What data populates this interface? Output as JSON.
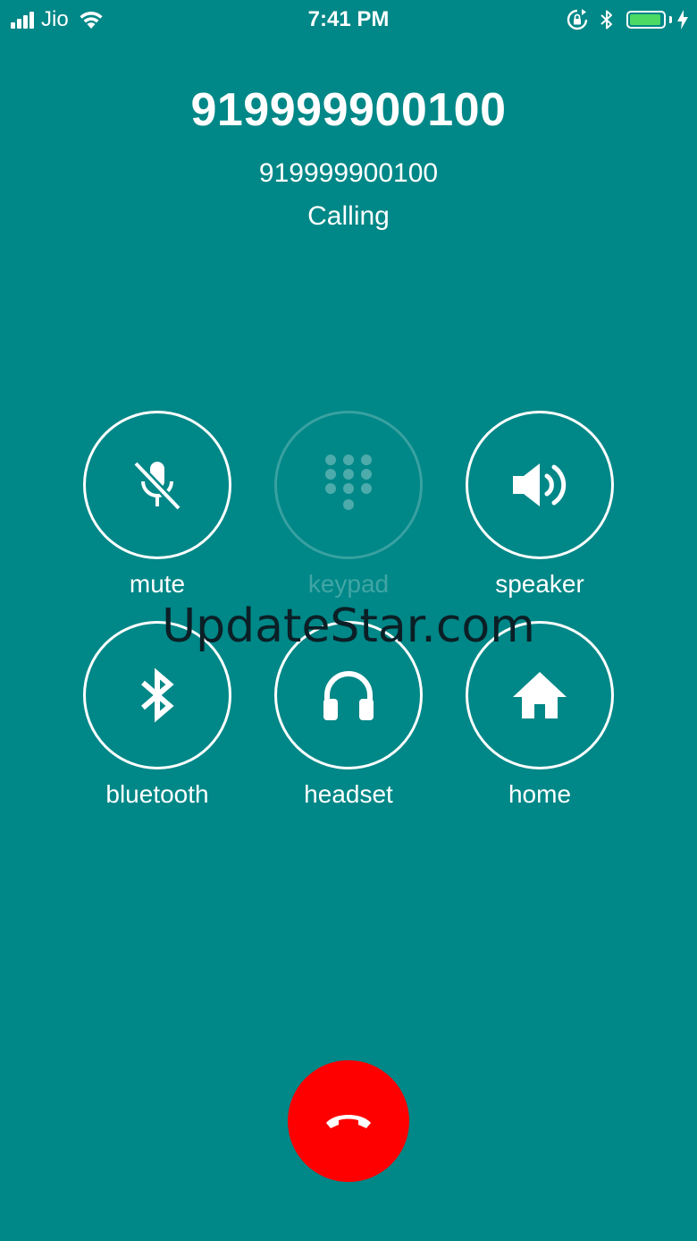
{
  "status_bar": {
    "carrier": "Jio",
    "time": "7:41 PM",
    "signal_icon": "cellular-signal-icon",
    "wifi_icon": "wifi-icon",
    "rotation_lock_icon": "rotation-lock-icon",
    "bluetooth_icon": "bluetooth-icon",
    "battery_icon": "battery-icon",
    "battery_level": 0.95,
    "battery_color": "#4cd964",
    "charging_icon": "charging-bolt-icon"
  },
  "call": {
    "caller_name": "919999900100",
    "caller_number": "919999900100",
    "status": "Calling"
  },
  "controls": [
    {
      "id": "mute",
      "label": "mute",
      "icon": "microphone-muted-icon",
      "enabled": true
    },
    {
      "id": "keypad",
      "label": "keypad",
      "icon": "keypad-icon",
      "enabled": false
    },
    {
      "id": "speaker",
      "label": "speaker",
      "icon": "speaker-icon",
      "enabled": true
    },
    {
      "id": "bluetooth",
      "label": "bluetooth",
      "icon": "bluetooth-icon",
      "enabled": true
    },
    {
      "id": "headset",
      "label": "headset",
      "icon": "headphones-icon",
      "enabled": true
    },
    {
      "id": "home",
      "label": "home",
      "icon": "house-icon",
      "enabled": true
    }
  ],
  "watermark": "UpdateStar.com",
  "end_call": {
    "icon": "hang-up-phone-icon",
    "color": "#ff0000"
  },
  "colors": {
    "background": "#008787",
    "foreground": "#ffffff"
  }
}
